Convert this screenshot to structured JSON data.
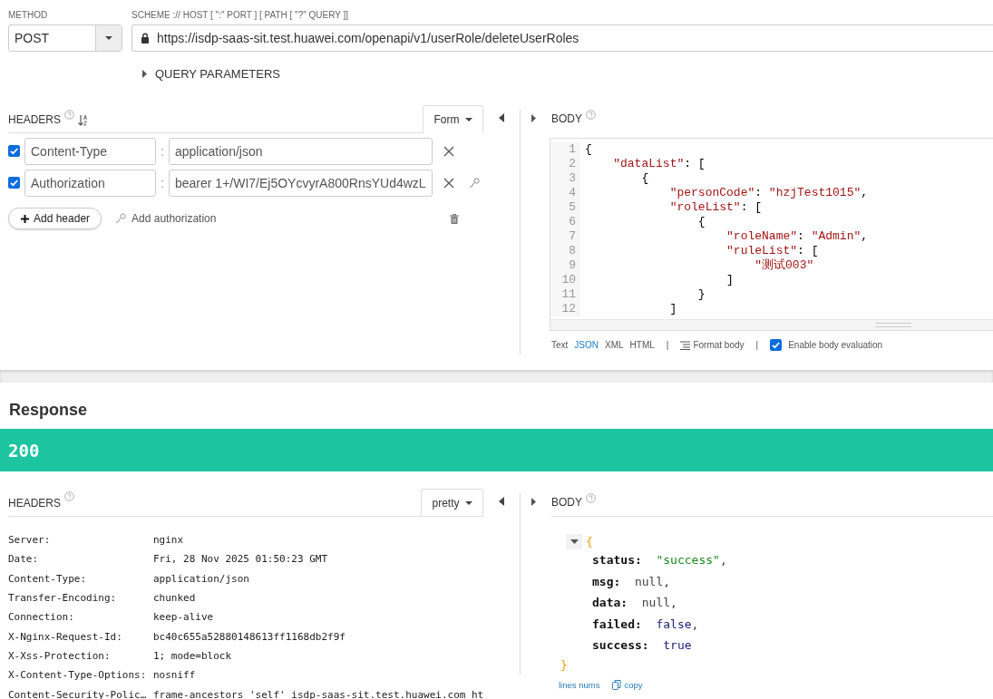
{
  "request": {
    "method": {
      "label": "METHOD",
      "value": "POST"
    },
    "url": {
      "label": "SCHEME :// HOST [ \":\" PORT ] [ PATH [ \"?\" QUERY ]]",
      "value": "https://isdp-saas-sit.test.huawei.com/openapi/v1/userRole/deleteUserRoles"
    },
    "query_parameters": {
      "label": "QUERY PARAMETERS",
      "expanded": false
    },
    "headers": {
      "title": "HEADERS",
      "mode": "Form",
      "rows": [
        {
          "checked": true,
          "name": "Content-Type",
          "separator": ":",
          "value": "application/json",
          "key_icon": false
        },
        {
          "checked": true,
          "name": "Authorization",
          "separator": ":",
          "value": "bearer 1+/WI7/Ej5OYcvyrA800RnsYUd4wzL",
          "key_icon": true
        }
      ],
      "add_header": "Add header",
      "add_authorization": "Add authorization"
    },
    "body": {
      "title": "BODY",
      "lines": [
        {
          "number": "1",
          "text": "{"
        },
        {
          "number": "2",
          "text": "    \"dataList\": ["
        },
        {
          "number": "3",
          "text": "        {"
        },
        {
          "number": "4",
          "text": "            \"personCode\": \"hzjTest1015\","
        },
        {
          "number": "5",
          "text": "            \"roleList\": ["
        },
        {
          "number": "6",
          "text": "                {"
        },
        {
          "number": "7",
          "text": "                    \"roleName\": \"Admin\","
        },
        {
          "number": "8",
          "text": "                    \"ruleList\": ["
        },
        {
          "number": "9",
          "text": "                        \"测试003\""
        },
        {
          "number": "10",
          "text": "                    ]"
        },
        {
          "number": "11",
          "text": "                }"
        },
        {
          "number": "12",
          "text": "            ]"
        }
      ],
      "formats": [
        {
          "label": "Text",
          "selected": false
        },
        {
          "label": "JSON",
          "selected": true
        },
        {
          "label": "XML",
          "selected": false
        },
        {
          "label": "HTML",
          "selected": false
        }
      ],
      "divider": "|",
      "format_body": "Format body",
      "evaluation": {
        "label": "Enable body evaluation",
        "checked": true
      }
    }
  },
  "response": {
    "title": "Response",
    "status": "200",
    "headers": {
      "title": "HEADERS",
      "mode": "pretty",
      "rows": [
        {
          "name": "Server:",
          "value": "nginx"
        },
        {
          "name": "Date:",
          "value": "Fri, 28 Nov 2025 01:50:23 GMT"
        },
        {
          "name": "Content-Type:",
          "value": "application/json"
        },
        {
          "name": "Transfer-Encoding:",
          "value": "chunked"
        },
        {
          "name": "Connection:",
          "value": "keep-alive"
        },
        {
          "name": "X-Nginx-Request-Id:",
          "value": "bc40c655a52880148613ff1168db2f9f"
        },
        {
          "name": "X-Xss-Protection:",
          "value": "1; mode=block"
        },
        {
          "name": "X-Content-Type-Options:",
          "value": "nosniff"
        },
        {
          "name": "Content-Security-Polic…",
          "value": "frame-ancestors 'self' isdp-saas-sit.test.huawei.com ht"
        }
      ]
    },
    "body": {
      "title": "BODY",
      "expanded": true,
      "open": "{",
      "close": "}",
      "fields": [
        {
          "key": "status:",
          "value": "\"success\"",
          "kind": "string",
          "trail": ","
        },
        {
          "key": "msg:",
          "value": "null",
          "kind": "null",
          "trail": ","
        },
        {
          "key": "data:",
          "value": "null",
          "kind": "null",
          "trail": ","
        },
        {
          "key": "failed:",
          "value": "false",
          "kind": "boolean",
          "trail": ","
        },
        {
          "key": "success:",
          "value": "true",
          "kind": "boolean"
        }
      ],
      "lines_nums": "lines nums",
      "copy": "copy"
    }
  }
}
